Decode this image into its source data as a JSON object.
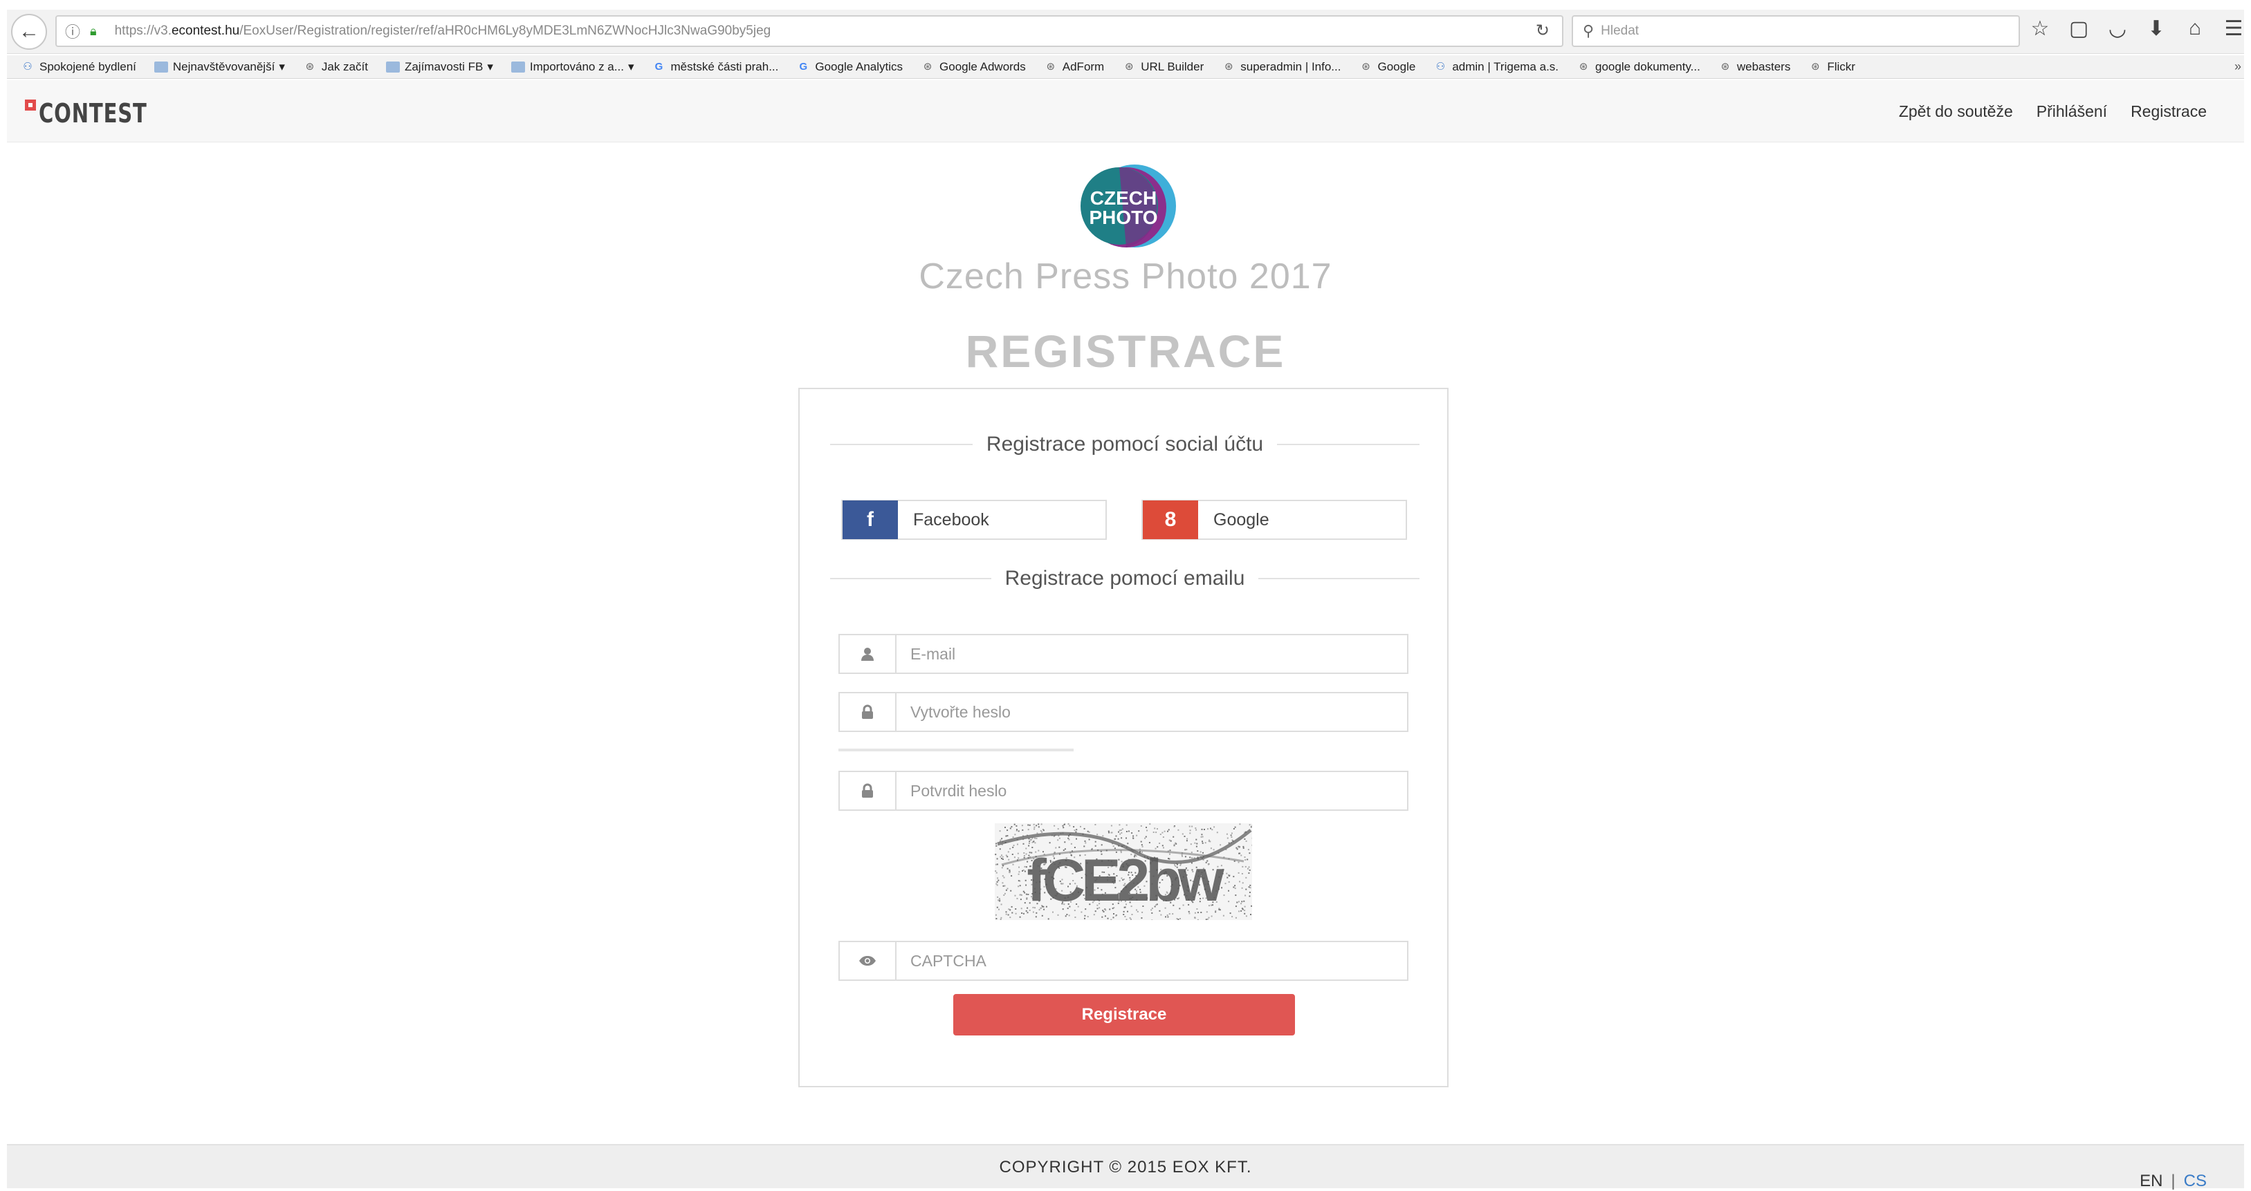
{
  "browser": {
    "url_prefix": "https://v3.",
    "url_domain": "econtest.hu",
    "url_path": "/EoxUser/Registration/register/ref/aHR0cHM6Ly8yMDE3LmN6ZWNocHJlc3NwaG90by5jeg",
    "search_placeholder": "Hledat",
    "bookmarks": [
      {
        "label": "Spokojené bydlení",
        "icon": "people-icon"
      },
      {
        "label": "Nejnavštěvovanější",
        "icon": "folder-icon",
        "dropdown": "▾"
      },
      {
        "label": "Jak začít",
        "icon": "globe-icon"
      },
      {
        "label": "Zajímavosti FB",
        "icon": "folder-icon",
        "dropdown": "▾"
      },
      {
        "label": "Importováno z a...",
        "icon": "folder-icon",
        "dropdown": "▾"
      },
      {
        "label": "městské části prah...",
        "icon": "google-icon"
      },
      {
        "label": "Google Analytics",
        "icon": "google-icon"
      },
      {
        "label": "Google Adwords",
        "icon": "globe-icon"
      },
      {
        "label": "AdForm",
        "icon": "globe-icon"
      },
      {
        "label": "URL Builder",
        "icon": "globe-icon"
      },
      {
        "label": "superadmin | Info...",
        "icon": "globe-icon"
      },
      {
        "label": "Google",
        "icon": "globe-icon"
      },
      {
        "label": "admin | Trigema a.s.",
        "icon": "people-icon"
      },
      {
        "label": "google dokumenty...",
        "icon": "globe-icon"
      },
      {
        "label": "webasters",
        "icon": "globe-icon"
      },
      {
        "label": "Flickr",
        "icon": "globe-icon"
      }
    ],
    "bookmarks_overflow": "»"
  },
  "header": {
    "logo_text": "CONTEST",
    "nav": [
      {
        "label": "Zpět do soutěže"
      },
      {
        "label": "Přihlášení"
      },
      {
        "label": "Registrace"
      }
    ]
  },
  "brand": {
    "logo_line1": "CZECH",
    "logo_line2": "PHOTO",
    "title": "Czech Press Photo 2017",
    "colors": {
      "teal": "#1f7f86",
      "purple": "#8b2f8c",
      "blue": "#2aa6d5"
    }
  },
  "page_title": "REGISTRACE",
  "form": {
    "social_heading": "Registrace pomocí social účtu",
    "facebook_label": "Facebook",
    "facebook_glyph": "f",
    "google_label": "Google",
    "google_glyph": "8",
    "email_heading": "Registrace pomocí emailu",
    "email_placeholder": "E-mail",
    "password_placeholder": "Vytvořte heslo",
    "confirm_placeholder": "Potvrdit heslo",
    "captcha_text": "fCE2bw",
    "captcha_placeholder": "CAPTCHA",
    "submit_label": "Registrace",
    "colors": {
      "facebook": "#3b5998",
      "google": "#dd4b39",
      "submit": "#e05653"
    }
  },
  "footer": {
    "copyright": "COPYRIGHT © 2015 EOX KFT.",
    "lang_en": "EN",
    "lang_sep": "|",
    "lang_cs": "CS"
  }
}
